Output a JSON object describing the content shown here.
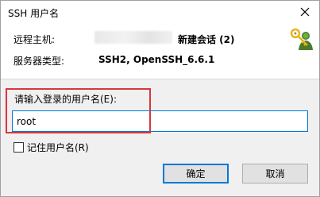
{
  "window": {
    "title": "SSH 用户名",
    "close_icon": "close-icon"
  },
  "info": {
    "host_label": "远程主机:",
    "host_value": "新建会话 (2)",
    "server_type_label": "服务器类型:",
    "server_type_value": "SSH2, OpenSSH_6.6.1",
    "icon": "keys-icon"
  },
  "form": {
    "prompt_label": "请输入登录的用户名(E):",
    "username_value": "root",
    "remember_label": "记住用户名(R)",
    "remember_checked": false
  },
  "buttons": {
    "ok_label": "确定",
    "cancel_label": "取消"
  },
  "colors": {
    "highlight_border": "#d9363e",
    "focus_blue": "#0078d7"
  }
}
